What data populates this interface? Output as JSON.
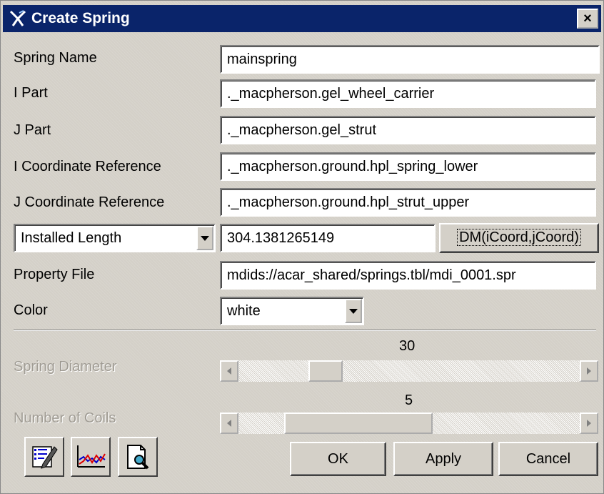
{
  "window": {
    "title": "Create Spring",
    "close_label": "×"
  },
  "fields": {
    "spring_name": {
      "label": "Spring Name",
      "value": "mainspring"
    },
    "i_part": {
      "label": "I Part",
      "value": "._macpherson.gel_wheel_carrier"
    },
    "j_part": {
      "label": "J Part",
      "value": "._macpherson.gel_strut"
    },
    "i_coord": {
      "label": "I Coordinate Reference",
      "value": "._macpherson.ground.hpl_spring_lower"
    },
    "j_coord": {
      "label": "J Coordinate Reference",
      "value": "._macpherson.ground.hpl_strut_upper"
    },
    "length": {
      "mode": "Installed Length",
      "value": "304.1381265149",
      "button": "DM(iCoord,jCoord)"
    },
    "property_file": {
      "label": "Property File",
      "value": "mdids://acar_shared/springs.tbl/mdi_0001.spr"
    },
    "color": {
      "label": "Color",
      "value": "white"
    }
  },
  "sliders": {
    "diameter": {
      "label": "Spring Diameter",
      "value": "30"
    },
    "coils": {
      "label": "Number of Coils",
      "value": "5"
    }
  },
  "buttons": {
    "ok": "OK",
    "apply": "Apply",
    "cancel": "Cancel"
  },
  "icons": [
    "edit-properties-icon",
    "plot-icon",
    "view-file-icon"
  ]
}
